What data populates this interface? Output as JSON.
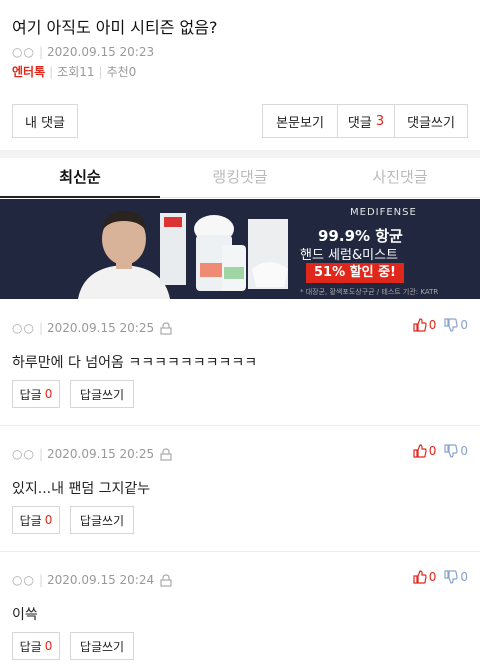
{
  "post": {
    "title": "여기 아직도 아미 시티즌 없음?",
    "author": "○○",
    "datetime": "2020.09.15 20:23",
    "category": "엔터톡",
    "views": "조회11",
    "recommend": "추천0"
  },
  "actions": {
    "my_comments": "내 댓글",
    "view_body": "본문보기",
    "comments_label": "댓글",
    "comments_count": "3",
    "write_comment": "댓글쓰기"
  },
  "tabs": [
    {
      "label": "최신순",
      "active": true
    },
    {
      "label": "랭킹댓글",
      "active": false
    },
    {
      "label": "사진댓글",
      "active": false
    }
  ],
  "banner": {
    "brand": "MEDIFENSE",
    "headline": "99.9% 항균",
    "sub": "핸드 세럼&미스트",
    "sale": "51% 할인 중!",
    "note": "* 대장균, 황색포도상구균 / 테스트 기관: KATR"
  },
  "comments": [
    {
      "author": "○○",
      "datetime": "2020.09.15 20:25",
      "text": "하루만에 다 넘어옴 ㅋㅋㅋㅋㅋㅋㅋㅋㅋㅋ",
      "up": "0",
      "down": "0",
      "reply_label": "답글",
      "reply_count": "0",
      "write_reply": "답글쓰기"
    },
    {
      "author": "○○",
      "datetime": "2020.09.15 20:25",
      "text": "있지...내 팬덤 그지같누",
      "up": "0",
      "down": "0",
      "reply_label": "답글",
      "reply_count": "0",
      "write_reply": "답글쓰기"
    },
    {
      "author": "○○",
      "datetime": "2020.09.15 20:24",
      "text": "이쓱",
      "up": "0",
      "down": "0",
      "reply_label": "답글",
      "reply_count": "0",
      "write_reply": "답글쓰기"
    }
  ],
  "colors": {
    "accent": "#e0271b",
    "banner_bg": "#20273f"
  }
}
